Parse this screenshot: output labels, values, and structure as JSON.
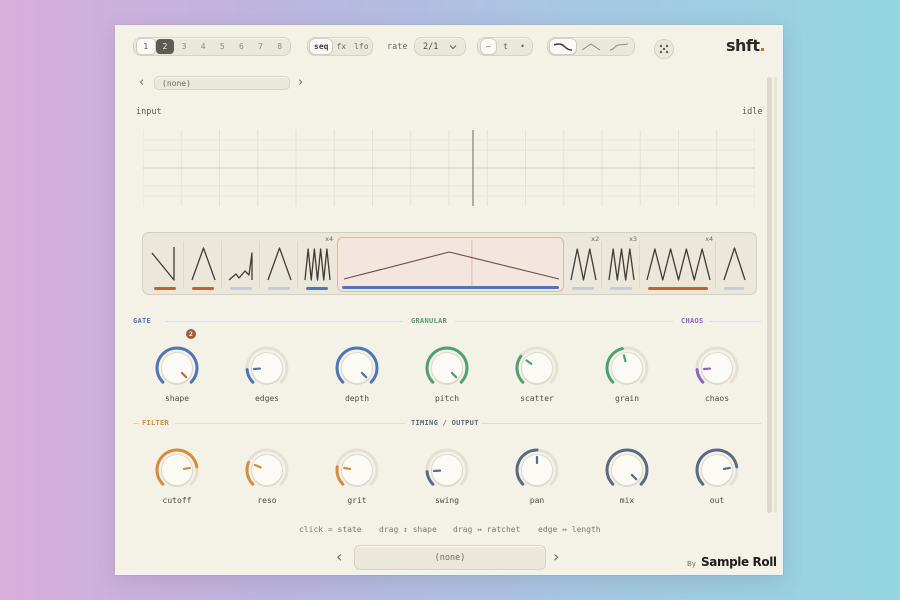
{
  "slots": [
    {
      "label": "1",
      "state": "on"
    },
    {
      "label": "2",
      "state": "active"
    },
    {
      "label": "3",
      "state": ""
    },
    {
      "label": "4",
      "state": ""
    },
    {
      "label": "5",
      "state": ""
    },
    {
      "label": "6",
      "state": ""
    },
    {
      "label": "7",
      "state": ""
    },
    {
      "label": "8",
      "state": ""
    }
  ],
  "modes": [
    {
      "label": "seq",
      "on": true
    },
    {
      "label": "fx",
      "on": false
    },
    {
      "label": "lfo",
      "on": false
    }
  ],
  "rate": {
    "label": "rate",
    "value": "2/1"
  },
  "tools": [
    {
      "glyph": "—",
      "on": true
    },
    {
      "glyph": "t",
      "on": false
    },
    {
      "glyph": "•",
      "on": false
    }
  ],
  "curve_icons": [
    "curve-down-icon",
    "curve-triangle-icon",
    "curve-rise-icon"
  ],
  "logo": {
    "text": "shft",
    "dot": "."
  },
  "preset_top": "(none)",
  "monitor": {
    "left": "input",
    "right": "idle"
  },
  "steps": [
    {
      "shape": "saw-down",
      "mult": "",
      "bar": "#c2603c"
    },
    {
      "shape": "triangle",
      "mult": "",
      "bar": "#c2603c"
    },
    {
      "shape": "ramp-steps",
      "mult": "",
      "bar": "#c6cbd8"
    },
    {
      "shape": "triangle",
      "mult": "",
      "bar": "#c6cbd8"
    },
    {
      "shape": "multi-tri",
      "mult": "x4",
      "bar": "#4f75b8"
    },
    {
      "shape": "big-triangle",
      "mult": "",
      "bar": "#4f75b8",
      "selected": true
    },
    {
      "shape": "multi-tri",
      "mult": "x2",
      "bar": "#c6cbd8"
    },
    {
      "shape": "multi-tri",
      "mult": "x3",
      "bar": "#c6cbd8"
    },
    {
      "shape": "multi-tri",
      "mult": "x4",
      "bar": "#c2603c"
    },
    {
      "shape": "triangle",
      "mult": "",
      "bar": "#c6cbd8"
    }
  ],
  "sections": {
    "gate": {
      "label": "GATE",
      "color": "#4f75b8"
    },
    "granular": {
      "label": "GRANULAR",
      "color": "#4ea073"
    },
    "chaos": {
      "label": "CHAOS",
      "color": "#8a63c9"
    },
    "filter": {
      "label": "FILTER",
      "color": "#d58c3c"
    },
    "timing": {
      "label": "TIMING / OUTPUT",
      "color": "#5b6a82"
    }
  },
  "badge": "2",
  "knobs_row1": [
    {
      "label": "shape",
      "color": "#4f75b8",
      "value": 1.0,
      "ind": "#b0704f"
    },
    {
      "label": "edges",
      "color": "#4f75b8",
      "value": 0.15,
      "ind": "#4f75b8"
    },
    {
      "label": "depth",
      "color": "#4f75b8",
      "value": 1.0,
      "ind": "#4f75b8"
    },
    {
      "label": "pitch",
      "color": "#4ea073",
      "value": 1.0,
      "ind": "#4ea073"
    },
    {
      "label": "scatter",
      "color": "#4ea073",
      "value": 0.3,
      "ind": "#4ea073"
    },
    {
      "label": "grain",
      "color": "#4ea073",
      "value": 0.45,
      "ind": "#4ea073"
    },
    {
      "label": "chaos",
      "color": "#8a63c9",
      "value": 0.15,
      "ind": "#8a63c9"
    }
  ],
  "knobs_row2": [
    {
      "label": "cutoff",
      "color": "#d58c3c",
      "value": 0.8,
      "ind": "#d58c3c"
    },
    {
      "label": "reso",
      "color": "#d58c3c",
      "value": 0.25,
      "ind": "#d58c3c"
    },
    {
      "label": "grit",
      "color": "#d58c3c",
      "value": 0.2,
      "ind": "#d58c3c"
    },
    {
      "label": "swing",
      "color": "#5b6a82",
      "value": 0.15,
      "ind": "#5b6a82"
    },
    {
      "label": "pan",
      "color": "#5b6a82",
      "value": 0.5,
      "ind": "#5b6a82"
    },
    {
      "label": "mix",
      "color": "#5b6a82",
      "value": 1.0,
      "ind": "#5b6a82"
    },
    {
      "label": "out",
      "color": "#5b6a82",
      "value": 0.8,
      "ind": "#5b6a82"
    }
  ],
  "hints": [
    "click = state",
    "drag ↕ shape",
    "drag ↔ ratchet",
    "edge ↔ length"
  ],
  "preset_bottom": "(none)",
  "brand": {
    "by": "By",
    "name": "Sample Roll"
  }
}
